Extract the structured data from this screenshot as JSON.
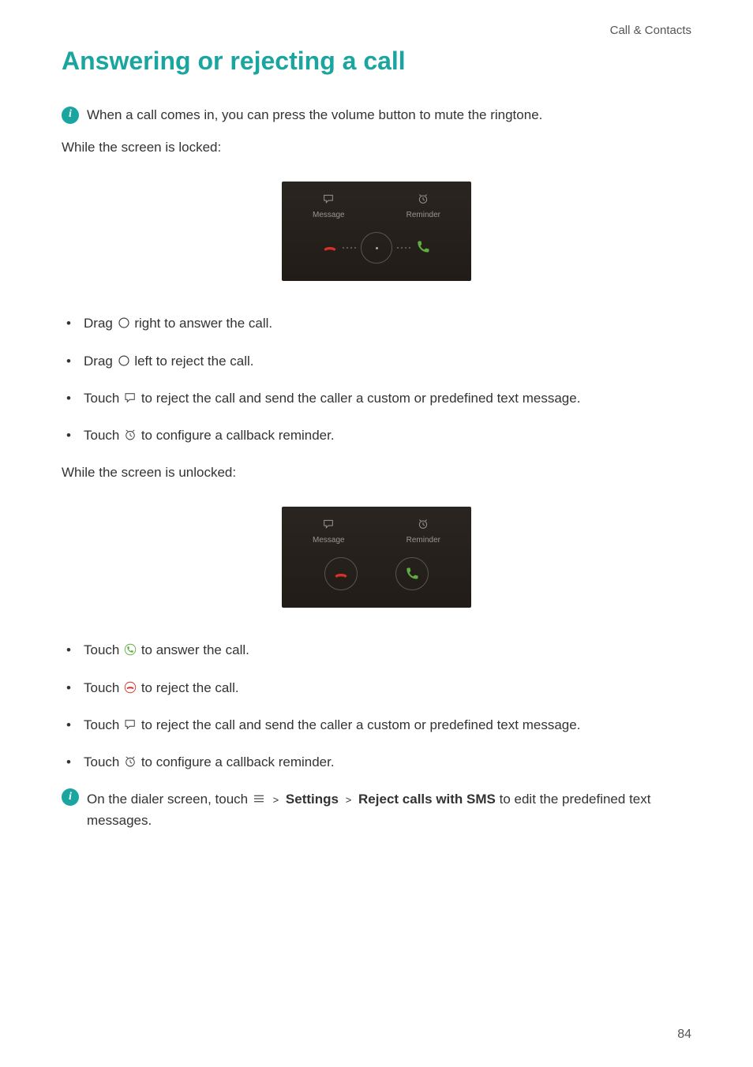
{
  "header": {
    "section": "Call & Contacts"
  },
  "title": "Answering or rejecting a call",
  "tip1": "When a call comes in, you can press the volume button to mute the ringtone.",
  "locked_intro": "While the screen is locked:",
  "ui": {
    "message": "Message",
    "reminder": "Reminder"
  },
  "locked_list": {
    "i1a": "Drag ",
    "i1b": "right to answer the call.",
    "i2a": "Drag ",
    "i2b": "left to reject the call.",
    "i3a": "Touch ",
    "i3b": "to reject the call and send the caller a custom or predefined text message.",
    "i4a": "Touch ",
    "i4b": "to configure a callback reminder."
  },
  "unlocked_intro": "While the screen is unlocked:",
  "unlocked_list": {
    "i1a": "Touch ",
    "i1b": "to answer the call.",
    "i2a": "Touch ",
    "i2b": "to reject the call.",
    "i3a": "Touch ",
    "i3b": "to reject the call and send the caller a custom or predefined text message.",
    "i4a": "Touch ",
    "i4b": "to configure a callback reminder."
  },
  "tip2": {
    "a": "On the dialer screen, touch ",
    "settings": "Settings",
    "reject": "Reject calls with SMS",
    "b": " to edit the predefined text messages."
  },
  "pagenum": "84"
}
